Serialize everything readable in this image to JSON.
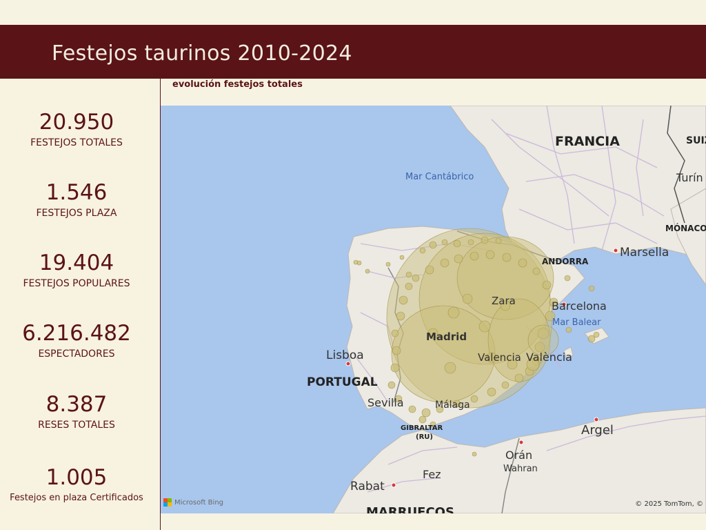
{
  "header": {
    "title": "Festejos taurinos 2010-2024"
  },
  "kpis": [
    {
      "value": "20.950",
      "label": "FESTEJOS TOTALES"
    },
    {
      "value": "1.546",
      "label": "FESTEJOS PLAZA"
    },
    {
      "value": "19.404",
      "label": "FESTEJOS POPULARES"
    },
    {
      "value": "6.216.482",
      "label": "ESPECTADORES"
    },
    {
      "value": "8.387",
      "label": "RESES TOTALES"
    },
    {
      "value": "1.005",
      "label": "Festejos en plaza Certificados"
    }
  ],
  "map": {
    "title": "evolución festejos totales",
    "attribution": "Microsoft Bing",
    "copyright": "© 2025 TomTom, ©",
    "labels": {
      "francia": "FRANCIA",
      "suiza": "SUIZ",
      "turin": "Turín",
      "monaco": "MÓNACO",
      "marsella": "Marsella",
      "andorra": "ANDORRA",
      "cantabrico": "Mar Cantábrico",
      "barcelona": "Barcelona",
      "balear": "Mar Balear",
      "valencia": "València",
      "valencia2": "Valencia",
      "lisboa": "Lisboa",
      "portugal": "PORTUGAL",
      "sevilla": "Sevilla",
      "malaga": "Málaga",
      "gibraltar": "GIBRALTAR",
      "ru": "(RU)",
      "argel": "Argel",
      "oran": "Orán",
      "wahran": "Wahran",
      "fez": "Fez",
      "rabat": "Rabat",
      "marruecos": "MARRUECOS",
      "zaragoza": "Zara",
      "madrid": "Madrid"
    },
    "colors": {
      "water": "#a9c6ed",
      "land": "#eceae2",
      "bubble": "#c9bd7a",
      "road": "#c9b3dd",
      "header": "#5a1316"
    }
  }
}
